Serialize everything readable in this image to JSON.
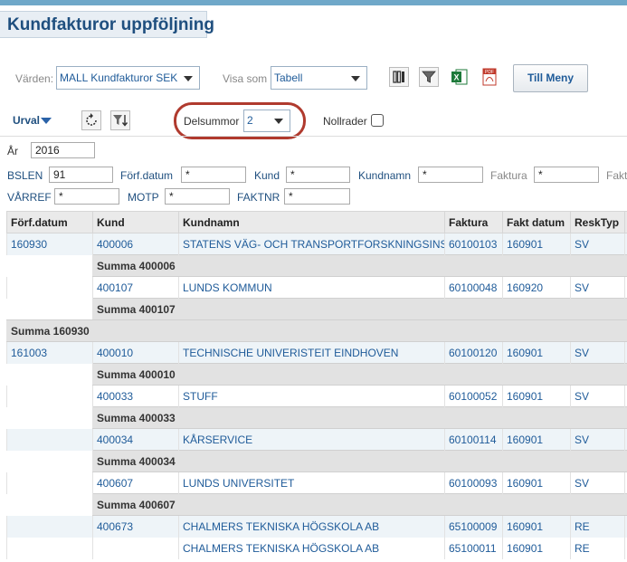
{
  "title": "Kundfakturor uppföljning",
  "toolbar": {
    "varden_label": "Värden:",
    "varden_value": "MALL Kundfakturor SEK",
    "visa_som_label": "Visa som",
    "visa_som_value": "Tabell",
    "menu_button": "Till Meny",
    "icons": [
      "columns-icon",
      "filter-icon",
      "excel-icon",
      "pdf-icon"
    ]
  },
  "options": {
    "urval_label": "Urval",
    "delsummor_label": "Delsummor",
    "delsummor_value": "2",
    "nollrader_label": "Nollrader",
    "nollrader_checked": false
  },
  "filters": {
    "ar_label": "År",
    "ar_value": "2016",
    "bslen_label": "BSLEN",
    "bslen_value": "91",
    "forfdatum_label": "Förf.datum",
    "forfdatum_value": "*",
    "kund_label": "Kund",
    "kund_value": "*",
    "kundnamn_label": "Kundnamn",
    "kundnamn_value": "*",
    "faktura_label": "Faktura",
    "faktura_value": "*",
    "fakt_label": "Fakt",
    "varref_label": "VÅRREF",
    "varref_value": "*",
    "motp_label": "MOTP",
    "motp_value": "*",
    "faktnr_label": "FAKTNR",
    "faktnr_value": "*"
  },
  "table": {
    "headers": [
      "Förf.datum",
      "Kund",
      "Kundnamn",
      "Faktura",
      "Fakt datum",
      "ReskTyp"
    ],
    "rows": [
      {
        "type": "data",
        "cells": [
          "160930",
          "400006",
          "STATENS VÄG- OCH TRANSPORTFORSKNINGSINST",
          "60100103",
          "160901",
          "SV"
        ]
      },
      {
        "type": "sub",
        "label": "Summa 400006"
      },
      {
        "type": "data",
        "cells": [
          "",
          "400107",
          "LUNDS KOMMUN",
          "60100048",
          "160920",
          "SV"
        ]
      },
      {
        "type": "sub",
        "label": "Summa 400107"
      },
      {
        "type": "grand",
        "label": "Summa 160930"
      },
      {
        "type": "data",
        "cells": [
          "161003",
          "400010",
          "TECHNISCHE UNIVERISTEIT EINDHOVEN",
          "60100120",
          "160901",
          "SV"
        ]
      },
      {
        "type": "sub",
        "label": "Summa 400010"
      },
      {
        "type": "data",
        "cells": [
          "",
          "400033",
          "STUFF",
          "60100052",
          "160901",
          "SV"
        ]
      },
      {
        "type": "sub",
        "label": "Summa 400033"
      },
      {
        "type": "data",
        "cells": [
          "",
          "400034",
          "KÅRSERVICE",
          "60100114",
          "160901",
          "SV"
        ]
      },
      {
        "type": "sub",
        "label": "Summa 400034"
      },
      {
        "type": "data",
        "cells": [
          "",
          "400607",
          "LUNDS UNIVERSITET",
          "60100093",
          "160901",
          "SV"
        ]
      },
      {
        "type": "sub",
        "label": "Summa 400607"
      },
      {
        "type": "data",
        "cells": [
          "",
          "400673",
          "CHALMERS TEKNISKA HÖGSKOLA AB",
          "65100009",
          "160901",
          "RE"
        ]
      },
      {
        "type": "data",
        "cells": [
          "",
          "",
          "CHALMERS TEKNISKA HÖGSKOLA AB",
          "65100011",
          "160901",
          "RE"
        ]
      }
    ]
  }
}
